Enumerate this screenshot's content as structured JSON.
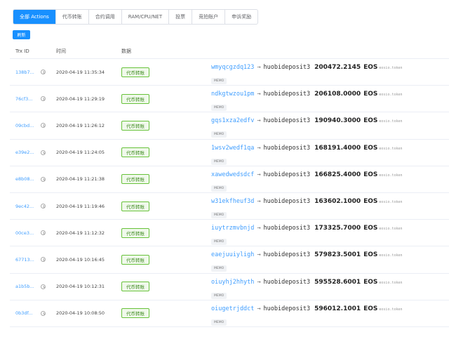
{
  "tabs": [
    "全部 Actions",
    "代币转账",
    "合约调用",
    "RAM/CPU/NET",
    "投票",
    "竞拍账户",
    "申诉奖励"
  ],
  "refresh_label": "刷新",
  "columns": {
    "trx_id": "Trx ID",
    "time": "时间",
    "data": "数据"
  },
  "arrow_symbol": "→",
  "rows": [
    {
      "id": "138b7...",
      "time": "2020-04-19 11:35:34",
      "tag": "代币转账",
      "from": "wmyqcgzdq123",
      "to": "huobideposit3",
      "amount": "200472.2145",
      "symbol": "EOS",
      "contract": "eosio.token",
      "memo": "MEMO"
    },
    {
      "id": "76cf3...",
      "time": "2020-04-19 11:29:19",
      "tag": "代币转账",
      "from": "ndkgtwzou1pm",
      "to": "huobideposit3",
      "amount": "206108.0000",
      "symbol": "EOS",
      "contract": "eosio.token",
      "memo": "MEMO"
    },
    {
      "id": "09cbd...",
      "time": "2020-04-19 11:26:12",
      "tag": "代币转账",
      "from": "gqs1xza2edfv",
      "to": "huobideposit3",
      "amount": "190940.3000",
      "symbol": "EOS",
      "contract": "eosio.token",
      "memo": "MEMO"
    },
    {
      "id": "e39e2...",
      "time": "2020-04-19 11:24:05",
      "tag": "代币转账",
      "from": "1wsv2wedf1qa",
      "to": "huobideposit3",
      "amount": "168191.4000",
      "symbol": "EOS",
      "contract": "eosio.token",
      "memo": "MEMO"
    },
    {
      "id": "e8b08...",
      "time": "2020-04-19 11:21:38",
      "tag": "代币转账",
      "from": "xawedwedsdcf",
      "to": "huobideposit3",
      "amount": "166825.4000",
      "symbol": "EOS",
      "contract": "eosio.token",
      "memo": "MEMO"
    },
    {
      "id": "9ec42...",
      "time": "2020-04-19 11:19:46",
      "tag": "代币转账",
      "from": "w31ekfheuf3d",
      "to": "huobideposit3",
      "amount": "163602.1000",
      "symbol": "EOS",
      "contract": "eosio.token",
      "memo": "MEMO"
    },
    {
      "id": "00ce3...",
      "time": "2020-04-19 11:12:32",
      "tag": "代币转账",
      "from": "iuytrzmvbnjd",
      "to": "huobideposit3",
      "amount": "173325.7000",
      "symbol": "EOS",
      "contract": "eosio.token",
      "memo": "MEMO"
    },
    {
      "id": "67713...",
      "time": "2020-04-19 10:16:45",
      "tag": "代币转账",
      "from": "eaejuuiyligh",
      "to": "huobideposit3",
      "amount": "579823.5001",
      "symbol": "EOS",
      "contract": "eosio.token",
      "memo": "MEMO"
    },
    {
      "id": "a1b5b...",
      "time": "2020-04-19 10:12:31",
      "tag": "代币转账",
      "from": "oiuyhj2hhyth",
      "to": "huobideposit3",
      "amount": "595528.6001",
      "symbol": "EOS",
      "contract": "eosio.token",
      "memo": "MEMO"
    },
    {
      "id": "0b3df...",
      "time": "2020-04-19 10:08:50",
      "tag": "代币转账",
      "from": "oiugetrjddct",
      "to": "huobideposit3",
      "amount": "596012.1001",
      "symbol": "EOS",
      "contract": "eosio.token",
      "memo": "MEMO"
    }
  ]
}
